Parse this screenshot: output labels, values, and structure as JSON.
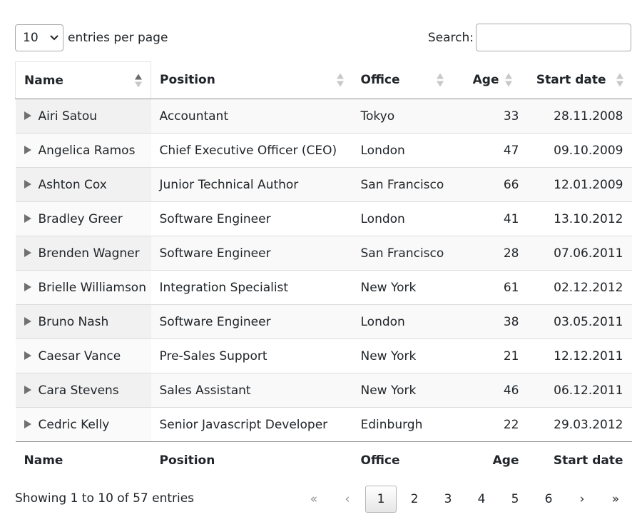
{
  "length_menu": {
    "selected": "10",
    "label": "entries per page"
  },
  "search": {
    "label": "Search:",
    "value": ""
  },
  "columns": [
    "Name",
    "Position",
    "Office",
    "Age",
    "Start date"
  ],
  "rows": [
    {
      "name": "Airi Satou",
      "position": "Accountant",
      "office": "Tokyo",
      "age": "33",
      "start": "28.11.2008"
    },
    {
      "name": "Angelica Ramos",
      "position": "Chief Executive Officer (CEO)",
      "office": "London",
      "age": "47",
      "start": "09.10.2009"
    },
    {
      "name": "Ashton Cox",
      "position": "Junior Technical Author",
      "office": "San Francisco",
      "age": "66",
      "start": "12.01.2009"
    },
    {
      "name": "Bradley Greer",
      "position": "Software Engineer",
      "office": "London",
      "age": "41",
      "start": "13.10.2012"
    },
    {
      "name": "Brenden Wagner",
      "position": "Software Engineer",
      "office": "San Francisco",
      "age": "28",
      "start": "07.06.2011"
    },
    {
      "name": "Brielle Williamson",
      "position": "Integration Specialist",
      "office": "New York",
      "age": "61",
      "start": "02.12.2012"
    },
    {
      "name": "Bruno Nash",
      "position": "Software Engineer",
      "office": "London",
      "age": "38",
      "start": "03.05.2011"
    },
    {
      "name": "Caesar Vance",
      "position": "Pre-Sales Support",
      "office": "New York",
      "age": "21",
      "start": "12.12.2011"
    },
    {
      "name": "Cara Stevens",
      "position": "Sales Assistant",
      "office": "New York",
      "age": "46",
      "start": "06.12.2011"
    },
    {
      "name": "Cedric Kelly",
      "position": "Senior Javascript Developer",
      "office": "Edinburgh",
      "age": "22",
      "start": "29.03.2012"
    }
  ],
  "info": "Showing 1 to 10 of 57 entries",
  "pagination": {
    "first": "«",
    "prev": "‹",
    "next": "›",
    "last": "»",
    "pages": [
      "1",
      "2",
      "3",
      "4",
      "5",
      "6"
    ],
    "current": "1"
  },
  "colors": {
    "border": "#8f8f8f",
    "row_stripe": "#f9f9f9",
    "sorted_col": "#f1f1f1"
  }
}
